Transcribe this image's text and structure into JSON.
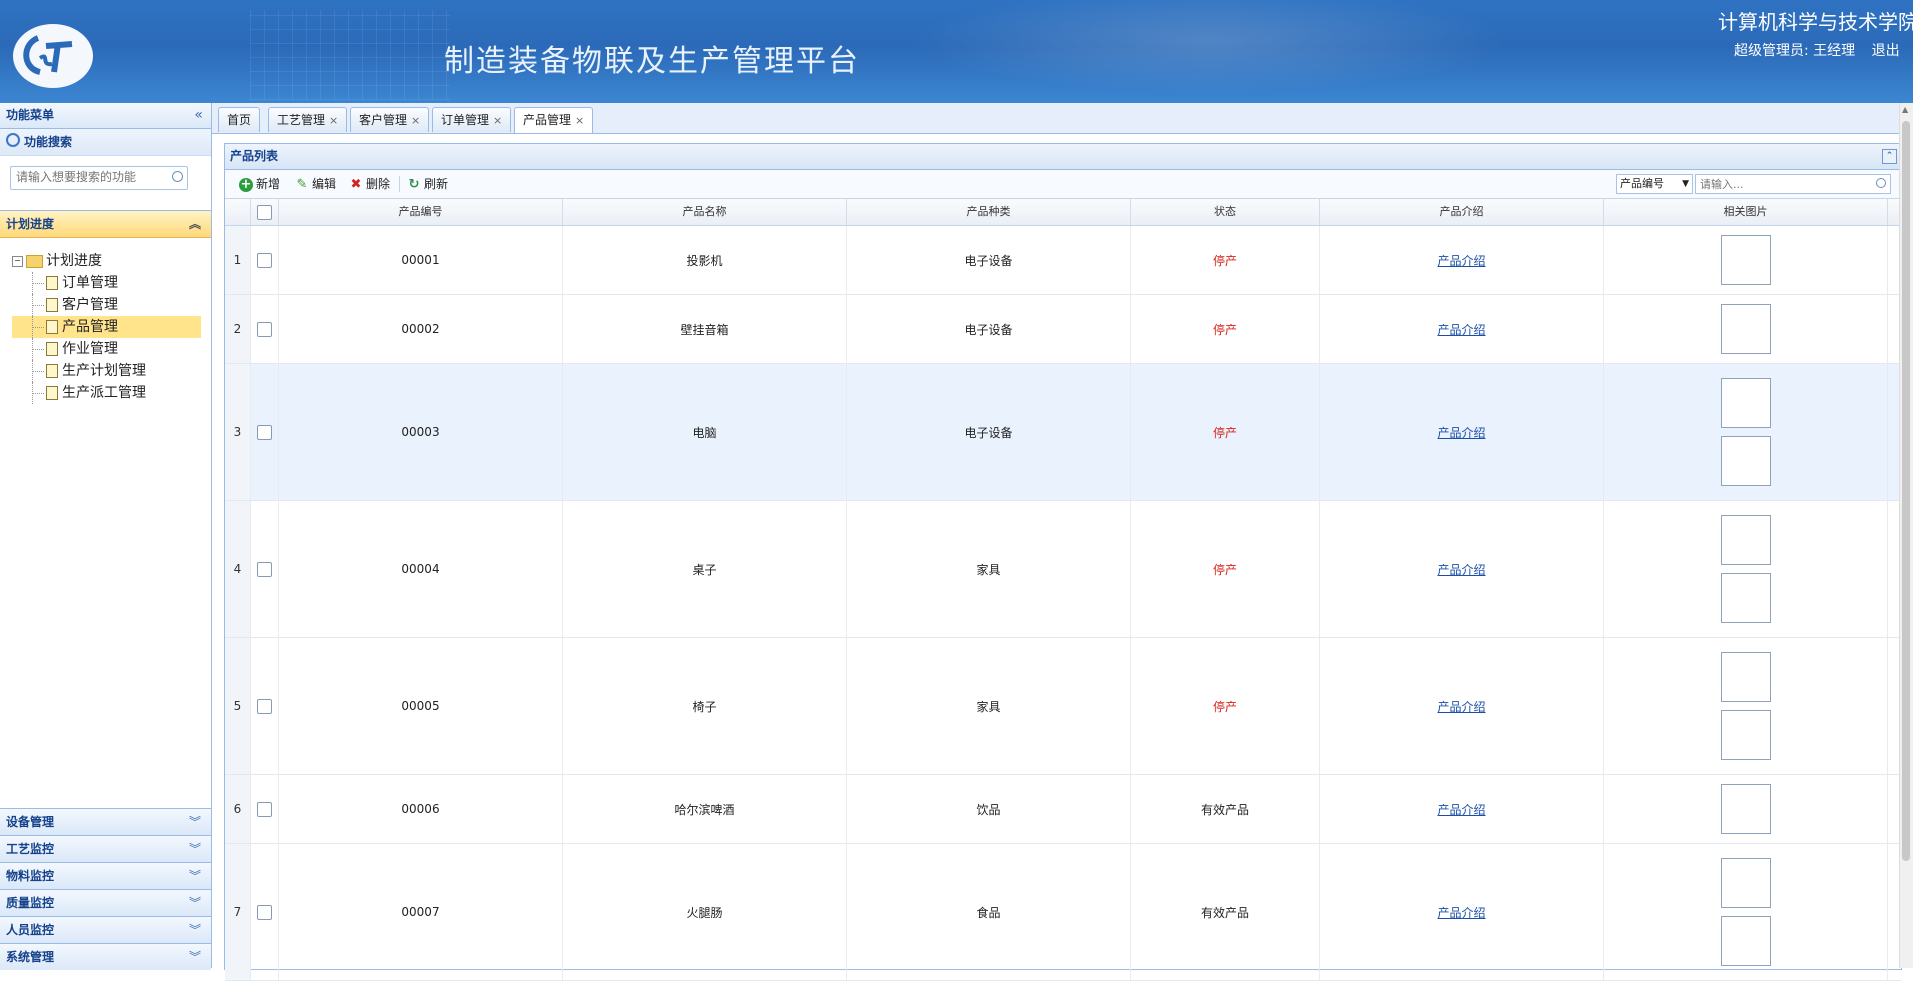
{
  "header": {
    "platform_title": "制造装备物联及生产管理平台",
    "college": "计算机科学与技术学院",
    "user": "超级管理员: 王经理",
    "logout": "退出"
  },
  "sidebar": {
    "title": "功能菜单",
    "collapse_glyph": "«",
    "search_title": "功能搜索",
    "search_placeholder": "请输入想要搜索的功能",
    "plan_section": "计划进度",
    "tree_root": "计划进度",
    "tree_items": [
      "订单管理",
      "客户管理",
      "产品管理",
      "作业管理",
      "生产计划管理",
      "生产派工管理"
    ],
    "active_item": "产品管理",
    "accordion": [
      "设备管理",
      "工艺监控",
      "物料监控",
      "质量监控",
      "人员监控",
      "系统管理"
    ]
  },
  "tabs": [
    {
      "label": "首页",
      "closable": false
    },
    {
      "label": "工艺管理",
      "closable": true
    },
    {
      "label": "客户管理",
      "closable": true
    },
    {
      "label": "订单管理",
      "closable": true
    },
    {
      "label": "产品管理",
      "closable": true,
      "active": true
    }
  ],
  "list": {
    "title": "产品列表",
    "toolbar": {
      "add": "新增",
      "edit": "编辑",
      "delete": "删除",
      "refresh": "刷新"
    },
    "filter_field": "产品编号",
    "filter_placeholder": "请输入...",
    "columns": [
      "产品编号",
      "产品名称",
      "产品种类",
      "状态",
      "产品介绍",
      "相关图片"
    ],
    "rows": [
      {
        "n": "1",
        "code": "00001",
        "name": "投影机",
        "kind": "电子设备",
        "status": "停产",
        "intro": "产品介绍",
        "images": 1
      },
      {
        "n": "2",
        "code": "00002",
        "name": "壁挂音箱",
        "kind": "电子设备",
        "status": "停产",
        "intro": "产品介绍",
        "images": 1
      },
      {
        "n": "3",
        "code": "00003",
        "name": "电脑",
        "kind": "电子设备",
        "status": "停产",
        "intro": "产品介绍",
        "images": 2,
        "selected": true
      },
      {
        "n": "4",
        "code": "00004",
        "name": "桌子",
        "kind": "家具",
        "status": "停产",
        "intro": "产品介绍",
        "images": 2
      },
      {
        "n": "5",
        "code": "00005",
        "name": "椅子",
        "kind": "家具",
        "status": "停产",
        "intro": "产品介绍",
        "images": 2
      },
      {
        "n": "6",
        "code": "00006",
        "name": "哈尔滨啤酒",
        "kind": "饮品",
        "status": "有效产品",
        "intro": "产品介绍",
        "images": 1
      },
      {
        "n": "7",
        "code": "00007",
        "name": "火腿肠",
        "kind": "食品",
        "status": "有效产品",
        "intro": "产品介绍",
        "images": 2
      }
    ]
  },
  "colors": {
    "accent": "#2f73c2",
    "stopped": "#d8231b",
    "link": "#1a4fa8",
    "selected_row": "#eaf2fd",
    "active_tree": "#ffe48c"
  }
}
